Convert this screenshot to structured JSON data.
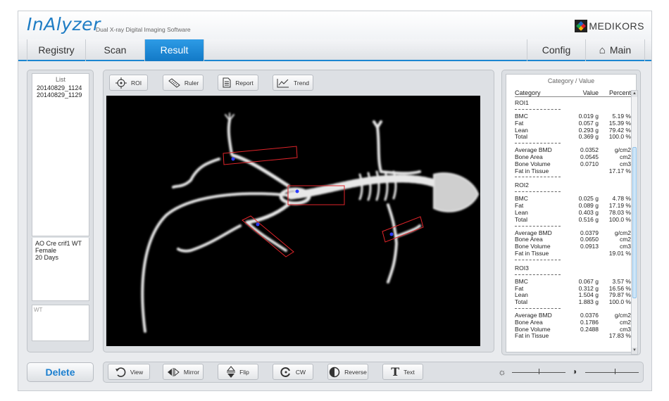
{
  "header": {
    "brand": "InAlyzer",
    "subtitle": "Dual X-ray Digital Imaging Software",
    "company": "MEDIKORS"
  },
  "tabs": {
    "registry": "Registry",
    "scan": "Scan",
    "result": "Result",
    "config": "Config",
    "main": "Main"
  },
  "list": {
    "title": "List",
    "items": [
      "20140829_1124",
      "20140829_1129"
    ],
    "info": [
      "AO Cre crif1 WT",
      "Female",
      "20 Days"
    ],
    "note": "WT"
  },
  "toolbar": {
    "roi": "ROI",
    "ruler": "Ruler",
    "report": "Report",
    "trend": "Trend"
  },
  "bottom": {
    "delete": "Delete",
    "view": "View",
    "mirror": "Mirror",
    "flip": "Flip",
    "cw": "CW",
    "reverse": "Reverse",
    "text": "Text",
    "brightness_level": 0.5,
    "contrast_level": 0.55
  },
  "results": {
    "title": "Category / Value",
    "headers": [
      "Category",
      "Value",
      "Percent"
    ],
    "rois": [
      {
        "name": "ROI1",
        "comp": [
          [
            "BMC",
            "0.019 g",
            "5.19 %"
          ],
          [
            "Fat",
            "0.057 g",
            "15.39 %"
          ],
          [
            "Lean",
            "0.293 g",
            "79.42 %"
          ],
          [
            "Total",
            "0.369 g",
            "100.0 %"
          ]
        ],
        "bone": [
          [
            "Average BMD",
            "0.0352",
            "g/cm2"
          ],
          [
            "Bone Area",
            "0.0545",
            "cm2"
          ],
          [
            "Bone Volume",
            "0.0710",
            "cm3"
          ],
          [
            "Fat in Tissue",
            "",
            "17.17 %"
          ]
        ]
      },
      {
        "name": "ROI2",
        "comp": [
          [
            "BMC",
            "0.025 g",
            "4.78 %"
          ],
          [
            "Fat",
            "0.089 g",
            "17.19 %"
          ],
          [
            "Lean",
            "0.403 g",
            "78.03 %"
          ],
          [
            "Total",
            "0.516 g",
            "100.0 %"
          ]
        ],
        "bone": [
          [
            "Average BMD",
            "0.0379",
            "g/cm2"
          ],
          [
            "Bone Area",
            "0.0650",
            "cm2"
          ],
          [
            "Bone Volume",
            "0.0913",
            "cm3"
          ],
          [
            "Fat in Tissue",
            "",
            "19.01 %"
          ]
        ]
      },
      {
        "name": "ROI3",
        "comp": [
          [
            "BMC",
            "0.067 g",
            "3.57 %"
          ],
          [
            "Fat",
            "0.312 g",
            "16.56 %"
          ],
          [
            "Lean",
            "1.504 g",
            "79.87 %"
          ],
          [
            "Total",
            "1.883 g",
            "100.0 %"
          ]
        ],
        "bone": [
          [
            "Average BMD",
            "0.0376",
            "g/cm2"
          ],
          [
            "Bone Area",
            "0.1786",
            "cm2"
          ],
          [
            "Bone Volume",
            "0.2488",
            "cm3"
          ],
          [
            "Fat in Tissue",
            "",
            "17.83 %"
          ]
        ]
      }
    ]
  },
  "colors": {
    "accent": "#1b86d2",
    "roi": "#e0242a",
    "marker": "#2b3bff"
  }
}
